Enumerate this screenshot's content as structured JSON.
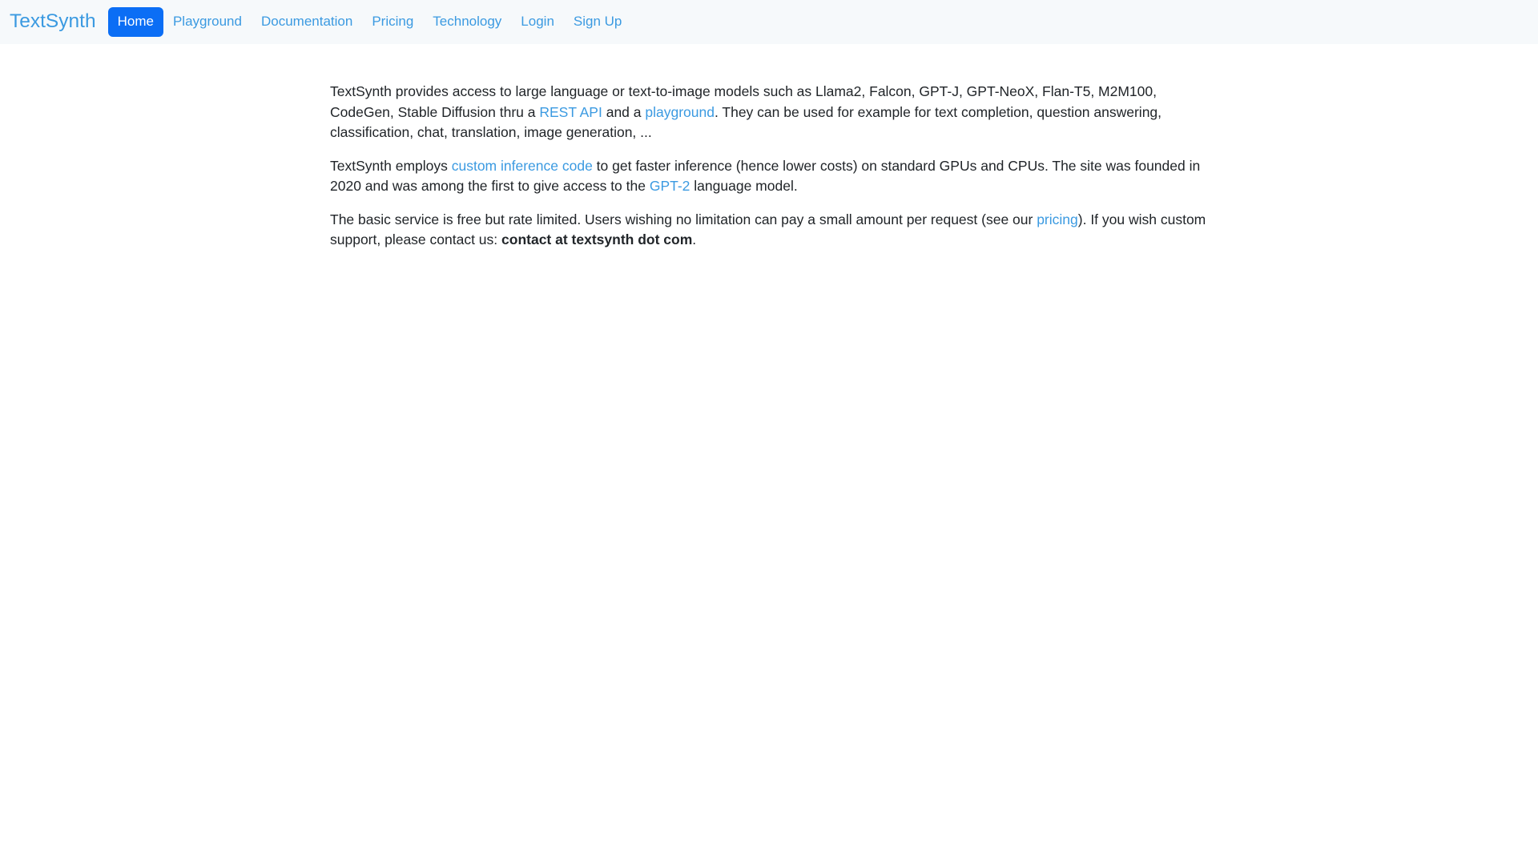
{
  "navbar": {
    "brand": "TextSynth",
    "items": [
      {
        "label": "Home",
        "active": true
      },
      {
        "label": "Playground",
        "active": false
      },
      {
        "label": "Documentation",
        "active": false
      },
      {
        "label": "Pricing",
        "active": false
      },
      {
        "label": "Technology",
        "active": false
      },
      {
        "label": "Login",
        "active": false
      },
      {
        "label": "Sign Up",
        "active": false
      }
    ],
    "colors": {
      "background": "#f6f9fb",
      "link": "#3b9ae1",
      "active_background": "#0b6ef5",
      "active_text": "#ffffff"
    }
  },
  "main": {
    "paragraph1": {
      "text_1": "TextSynth provides access to large language or text-to-image models such as Llama2, Falcon, GPT-J, GPT-NeoX, Flan-T5, M2M100, CodeGen, Stable Diffusion thru a ",
      "link_rest_api": "REST API",
      "text_2": " and a ",
      "link_playground": "playground",
      "text_3": ". They can be used for example for text completion, question answering, classification, chat, translation, image generation, ..."
    },
    "paragraph2": {
      "text_1": "TextSynth employs ",
      "link_custom_inference": "custom inference code",
      "text_2": " to get faster inference (hence lower costs) on standard GPUs and CPUs. The site was founded in 2020 and was among the first to give access to the ",
      "link_gpt2": "GPT-2",
      "text_3": " language model."
    },
    "paragraph3": {
      "text_1": "The basic service is free but rate limited. Users wishing no limitation can pay a small amount per request (see our ",
      "link_pricing": "pricing",
      "text_2": "). If you wish custom support, please contact us: ",
      "contact_bold": "contact at textsynth dot com",
      "text_3": "."
    }
  }
}
